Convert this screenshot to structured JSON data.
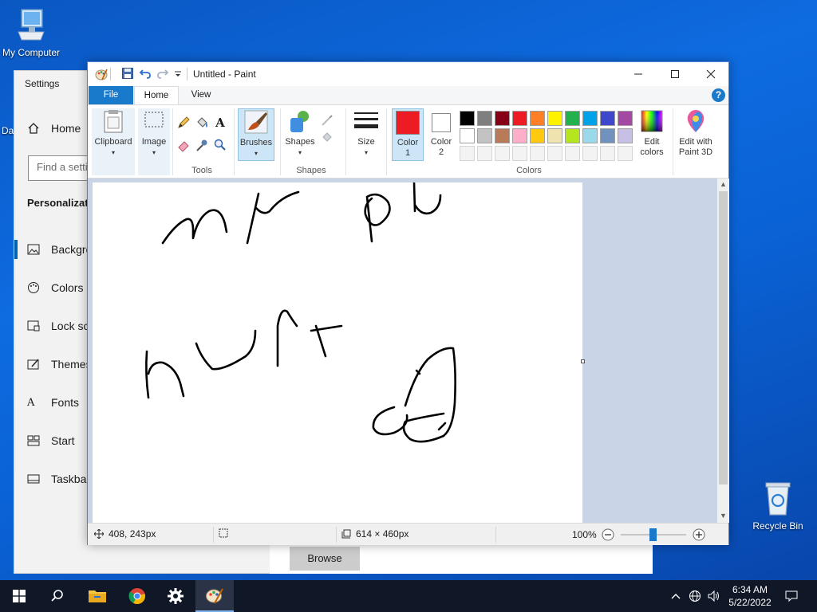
{
  "desktop": {
    "icons": [
      {
        "label": "My Computer"
      },
      {
        "label": "Recycle Bin"
      }
    ],
    "partial_icon_label": "Da"
  },
  "settings": {
    "title": "Settings",
    "home_label": "Home",
    "search_placeholder": "Find a setting",
    "section_title": "Personalization",
    "nav_items": [
      {
        "label": "Background",
        "icon": "image-icon"
      },
      {
        "label": "Colors",
        "icon": "palette-icon"
      },
      {
        "label": "Lock screen",
        "icon": "lock-screen-icon"
      },
      {
        "label": "Themes",
        "icon": "themes-icon"
      },
      {
        "label": "Fonts",
        "icon": "fonts-icon"
      },
      {
        "label": "Start",
        "icon": "start-icon"
      },
      {
        "label": "Taskbar",
        "icon": "taskbar-icon"
      }
    ],
    "browse_label": "Browse"
  },
  "paint": {
    "title": "Untitled - Paint",
    "tabs": {
      "file": "File",
      "home": "Home",
      "view": "View"
    },
    "help_label": "?",
    "ribbon": {
      "clipboard": "Clipboard",
      "image": "Image",
      "tools_group": "Tools",
      "brushes": "Brushes",
      "shapes": "Shapes",
      "shapes_group": "Shapes",
      "size": "Size",
      "color1_line1": "Color",
      "color1_line2": "1",
      "color2_line1": "Color",
      "color2_line2": "2",
      "colors_group": "Colors",
      "edit_colors_line1": "Edit",
      "edit_colors_line2": "colors",
      "paint3d_line1": "Edit with",
      "paint3d_line2": "Paint 3D"
    },
    "color1": "#ed1c24",
    "color2": "#ffffff",
    "palette_row1": [
      "#000000",
      "#7f7f7f",
      "#880015",
      "#ed1c24",
      "#ff7f27",
      "#fff200",
      "#22b14c",
      "#00a2e8",
      "#3f48cc",
      "#a349a4"
    ],
    "palette_row2": [
      "#ffffff",
      "#c3c3c3",
      "#b97a57",
      "#ffaec9",
      "#ffc90e",
      "#efe4b0",
      "#b5e61d",
      "#99d9ea",
      "#7092be",
      "#c8bfe7"
    ],
    "status": {
      "cursor_pos": "408, 243px",
      "canvas_size": "614 × 460px",
      "zoom": "100%"
    }
  },
  "taskbar": {
    "time": "6:34 AM",
    "date": "5/22/2022"
  }
}
